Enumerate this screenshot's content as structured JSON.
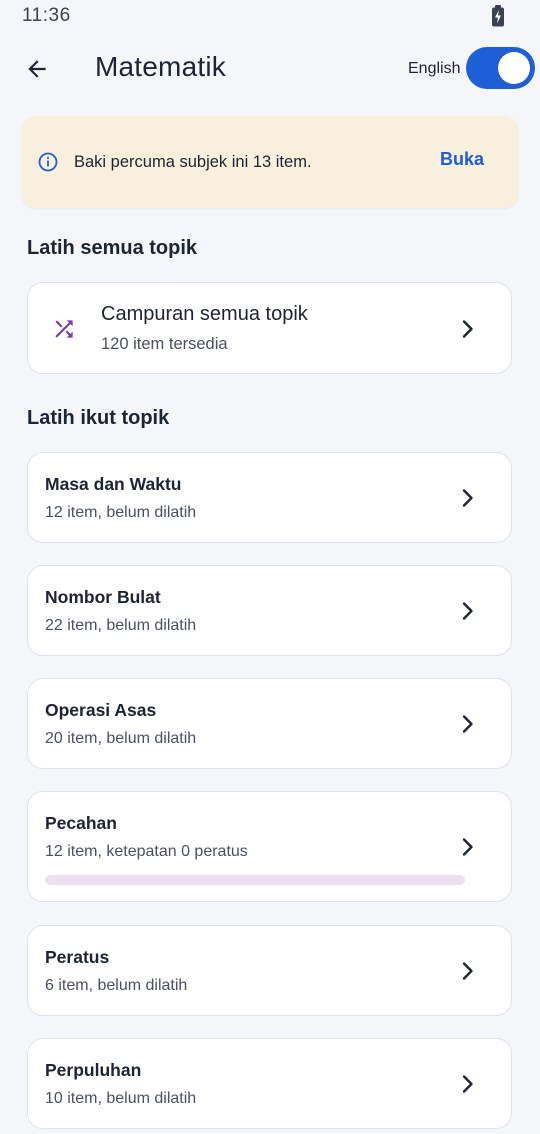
{
  "status_bar": {
    "time": "11:36",
    "battery_icon": "battery-charging-icon"
  },
  "app_bar": {
    "back_icon": "arrow-left-icon",
    "title": "Matematik",
    "language_label": "English",
    "language_toggle_on": true,
    "accent_color": "#1e5fd6"
  },
  "notice": {
    "icon": "info-icon",
    "text": "Baki percuma subjek ini 13 item.",
    "action_label": "Buka",
    "background_color": "#f8efdc"
  },
  "all_topics": {
    "section_title": "Latih semua topik",
    "card": {
      "icon": "shuffle-icon",
      "title": "Campuran semua topik",
      "subtitle": "120 item tersedia",
      "icon_color": "#7a3fa0"
    }
  },
  "by_topic": {
    "section_title": "Latih ikut topik",
    "topics": [
      {
        "title": "Masa dan Waktu",
        "subtitle": "12 item, belum dilatih"
      },
      {
        "title": "Nombor Bulat",
        "subtitle": "22 item, belum dilatih"
      },
      {
        "title": "Operasi Asas",
        "subtitle": "20 item, belum dilatih"
      },
      {
        "title": "Pecahan",
        "subtitle": "12 item, ketepatan 0 peratus",
        "progress": 0
      },
      {
        "title": "Peratus",
        "subtitle": "6 item, belum dilatih"
      },
      {
        "title": "Perpuluhan",
        "subtitle": "10 item, belum dilatih"
      }
    ]
  }
}
